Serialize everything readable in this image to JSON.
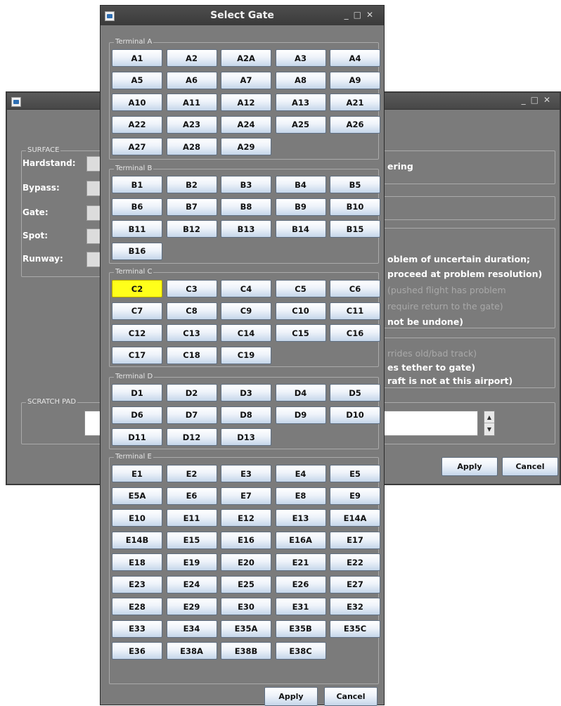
{
  "background_window": {
    "window_controls": [
      "_",
      "□",
      "✕"
    ],
    "surface": {
      "title": "SURFACE",
      "fields": [
        {
          "label": "Hardstand:"
        },
        {
          "label": "Bypass:"
        },
        {
          "label": "Gate:"
        },
        {
          "label": "Spot:"
        },
        {
          "label": "Runway:"
        }
      ]
    },
    "right_panel": {
      "box1_text": "ering",
      "box3_lines": [
        {
          "text": "oblem of uncertain duration;",
          "dim": false
        },
        {
          "text": "proceed at problem resolution)",
          "dim": false
        },
        {
          "text": "(pushed flight has problem",
          "dim": true
        },
        {
          "text": "require return to the gate)",
          "dim": true
        },
        {
          "text": "not be undone)",
          "dim": false
        }
      ],
      "box4_lines": [
        {
          "text": "rrides old/bad track)",
          "dim": true
        },
        {
          "text": "es tether to gate)",
          "dim": false
        },
        {
          "text": "raft is not at this airport)",
          "dim": false
        }
      ]
    },
    "scratch_pad": {
      "title": "SCRATCH PAD",
      "value": ""
    },
    "apply_label": "Apply",
    "cancel_label": "Cancel"
  },
  "dialog": {
    "title": "Select Gate",
    "window_controls": [
      "_",
      "□",
      "✕"
    ],
    "selected_gate": "C2",
    "terminals": [
      {
        "name": "Terminal A",
        "gates": [
          "A1",
          "A2",
          "A2A",
          "A3",
          "A4",
          "A5",
          "A6",
          "A7",
          "A8",
          "A9",
          "A10",
          "A11",
          "A12",
          "A13",
          "A21",
          "A22",
          "A23",
          "A24",
          "A25",
          "A26",
          "A27",
          "A28",
          "A29"
        ]
      },
      {
        "name": "Terminal B",
        "gates": [
          "B1",
          "B2",
          "B3",
          "B4",
          "B5",
          "B6",
          "B7",
          "B8",
          "B9",
          "B10",
          "B11",
          "B12",
          "B13",
          "B14",
          "B15",
          "B16"
        ]
      },
      {
        "name": "Terminal C",
        "gates": [
          "C2",
          "C3",
          "C4",
          "C5",
          "C6",
          "C7",
          "C8",
          "C9",
          "C10",
          "C11",
          "C12",
          "C13",
          "C14",
          "C15",
          "C16",
          "C17",
          "C18",
          "C19"
        ]
      },
      {
        "name": "Terminal D",
        "gates": [
          "D1",
          "D2",
          "D3",
          "D4",
          "D5",
          "D6",
          "D7",
          "D8",
          "D9",
          "D10",
          "D11",
          "D12",
          "D13"
        ]
      },
      {
        "name": "Terminal E",
        "gates": [
          "E1",
          "E2",
          "E3",
          "E4",
          "E5",
          "E5A",
          "E6",
          "E7",
          "E8",
          "E9",
          "E10",
          "E11",
          "E12",
          "E13",
          "E14A",
          "E14B",
          "E15",
          "E16",
          "E16A",
          "E17",
          "E18",
          "E19",
          "E20",
          "E21",
          "E22",
          "E23",
          "E24",
          "E25",
          "E26",
          "E27",
          "E28",
          "E29",
          "E30",
          "E31",
          "E32",
          "E33",
          "E34",
          "E35A",
          "E35B",
          "E35C",
          "E36",
          "E38A",
          "E38B",
          "E38C"
        ]
      }
    ],
    "apply_label": "Apply",
    "cancel_label": "Cancel"
  },
  "colors": {
    "panel": "#7b7b7b",
    "selected_gate": "#ffff1a",
    "titlebar": "#444444"
  }
}
